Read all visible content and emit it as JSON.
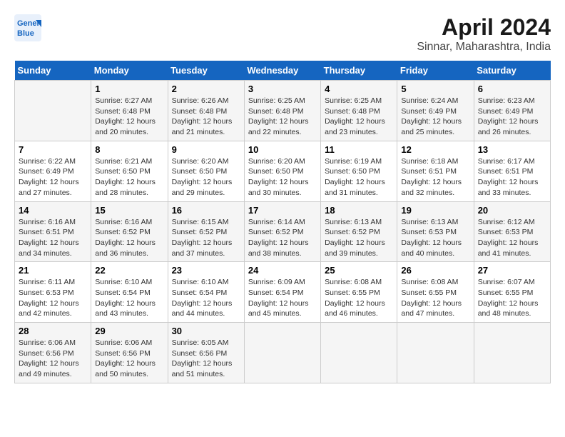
{
  "header": {
    "logo_line1": "General",
    "logo_line2": "Blue",
    "month": "April 2024",
    "location": "Sinnar, Maharashtra, India"
  },
  "days_of_week": [
    "Sunday",
    "Monday",
    "Tuesday",
    "Wednesday",
    "Thursday",
    "Friday",
    "Saturday"
  ],
  "weeks": [
    [
      {
        "day": "",
        "info": ""
      },
      {
        "day": "1",
        "info": "Sunrise: 6:27 AM\nSunset: 6:48 PM\nDaylight: 12 hours\nand 20 minutes."
      },
      {
        "day": "2",
        "info": "Sunrise: 6:26 AM\nSunset: 6:48 PM\nDaylight: 12 hours\nand 21 minutes."
      },
      {
        "day": "3",
        "info": "Sunrise: 6:25 AM\nSunset: 6:48 PM\nDaylight: 12 hours\nand 22 minutes."
      },
      {
        "day": "4",
        "info": "Sunrise: 6:25 AM\nSunset: 6:48 PM\nDaylight: 12 hours\nand 23 minutes."
      },
      {
        "day": "5",
        "info": "Sunrise: 6:24 AM\nSunset: 6:49 PM\nDaylight: 12 hours\nand 25 minutes."
      },
      {
        "day": "6",
        "info": "Sunrise: 6:23 AM\nSunset: 6:49 PM\nDaylight: 12 hours\nand 26 minutes."
      }
    ],
    [
      {
        "day": "7",
        "info": "Sunrise: 6:22 AM\nSunset: 6:49 PM\nDaylight: 12 hours\nand 27 minutes."
      },
      {
        "day": "8",
        "info": "Sunrise: 6:21 AM\nSunset: 6:50 PM\nDaylight: 12 hours\nand 28 minutes."
      },
      {
        "day": "9",
        "info": "Sunrise: 6:20 AM\nSunset: 6:50 PM\nDaylight: 12 hours\nand 29 minutes."
      },
      {
        "day": "10",
        "info": "Sunrise: 6:20 AM\nSunset: 6:50 PM\nDaylight: 12 hours\nand 30 minutes."
      },
      {
        "day": "11",
        "info": "Sunrise: 6:19 AM\nSunset: 6:50 PM\nDaylight: 12 hours\nand 31 minutes."
      },
      {
        "day": "12",
        "info": "Sunrise: 6:18 AM\nSunset: 6:51 PM\nDaylight: 12 hours\nand 32 minutes."
      },
      {
        "day": "13",
        "info": "Sunrise: 6:17 AM\nSunset: 6:51 PM\nDaylight: 12 hours\nand 33 minutes."
      }
    ],
    [
      {
        "day": "14",
        "info": "Sunrise: 6:16 AM\nSunset: 6:51 PM\nDaylight: 12 hours\nand 34 minutes."
      },
      {
        "day": "15",
        "info": "Sunrise: 6:16 AM\nSunset: 6:52 PM\nDaylight: 12 hours\nand 36 minutes."
      },
      {
        "day": "16",
        "info": "Sunrise: 6:15 AM\nSunset: 6:52 PM\nDaylight: 12 hours\nand 37 minutes."
      },
      {
        "day": "17",
        "info": "Sunrise: 6:14 AM\nSunset: 6:52 PM\nDaylight: 12 hours\nand 38 minutes."
      },
      {
        "day": "18",
        "info": "Sunrise: 6:13 AM\nSunset: 6:52 PM\nDaylight: 12 hours\nand 39 minutes."
      },
      {
        "day": "19",
        "info": "Sunrise: 6:13 AM\nSunset: 6:53 PM\nDaylight: 12 hours\nand 40 minutes."
      },
      {
        "day": "20",
        "info": "Sunrise: 6:12 AM\nSunset: 6:53 PM\nDaylight: 12 hours\nand 41 minutes."
      }
    ],
    [
      {
        "day": "21",
        "info": "Sunrise: 6:11 AM\nSunset: 6:53 PM\nDaylight: 12 hours\nand 42 minutes."
      },
      {
        "day": "22",
        "info": "Sunrise: 6:10 AM\nSunset: 6:54 PM\nDaylight: 12 hours\nand 43 minutes."
      },
      {
        "day": "23",
        "info": "Sunrise: 6:10 AM\nSunset: 6:54 PM\nDaylight: 12 hours\nand 44 minutes."
      },
      {
        "day": "24",
        "info": "Sunrise: 6:09 AM\nSunset: 6:54 PM\nDaylight: 12 hours\nand 45 minutes."
      },
      {
        "day": "25",
        "info": "Sunrise: 6:08 AM\nSunset: 6:55 PM\nDaylight: 12 hours\nand 46 minutes."
      },
      {
        "day": "26",
        "info": "Sunrise: 6:08 AM\nSunset: 6:55 PM\nDaylight: 12 hours\nand 47 minutes."
      },
      {
        "day": "27",
        "info": "Sunrise: 6:07 AM\nSunset: 6:55 PM\nDaylight: 12 hours\nand 48 minutes."
      }
    ],
    [
      {
        "day": "28",
        "info": "Sunrise: 6:06 AM\nSunset: 6:56 PM\nDaylight: 12 hours\nand 49 minutes."
      },
      {
        "day": "29",
        "info": "Sunrise: 6:06 AM\nSunset: 6:56 PM\nDaylight: 12 hours\nand 50 minutes."
      },
      {
        "day": "30",
        "info": "Sunrise: 6:05 AM\nSunset: 6:56 PM\nDaylight: 12 hours\nand 51 minutes."
      },
      {
        "day": "",
        "info": ""
      },
      {
        "day": "",
        "info": ""
      },
      {
        "day": "",
        "info": ""
      },
      {
        "day": "",
        "info": ""
      }
    ]
  ]
}
